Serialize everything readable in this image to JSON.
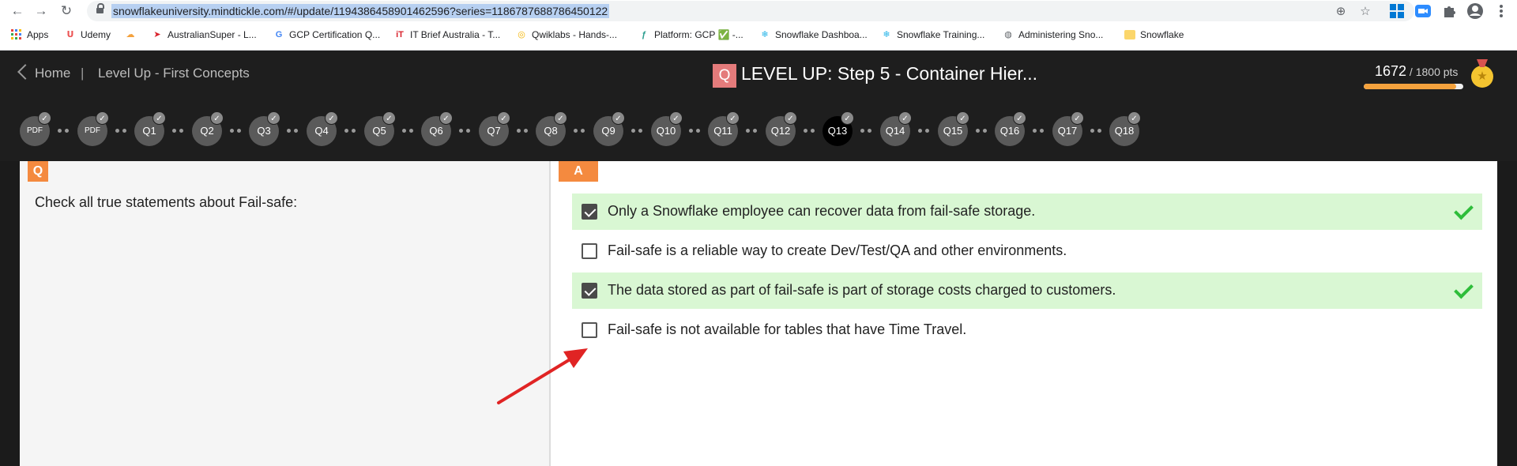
{
  "browser": {
    "url": "snowflakeuniversity.mindtickle.com/#/update/1194386458901462596?series=1186787688786450122",
    "bookmarks": [
      {
        "label": "Apps",
        "icon": "apps-grid-icon"
      },
      {
        "label": "Udemy",
        "icon": "udemy-icon"
      },
      {
        "label": "",
        "icon": "cloud-icon"
      },
      {
        "label": "AustralianSuper - L...",
        "icon": "australiansuper-icon"
      },
      {
        "label": "GCP Certification Q...",
        "icon": "google-icon"
      },
      {
        "label": "IT Brief Australia - T...",
        "icon": "itbrief-icon"
      },
      {
        "label": "Qwiklabs - Hands-...",
        "icon": "qwiklabs-icon"
      },
      {
        "label": "Platform: GCP ✅ -...",
        "icon": "platform-icon"
      },
      {
        "label": "Snowflake Dashboa...",
        "icon": "snowflake-icon"
      },
      {
        "label": "Snowflake Training...",
        "icon": "snowflake-icon"
      },
      {
        "label": "Administering Sno...",
        "icon": "globe-icon"
      },
      {
        "label": "Snowflake",
        "icon": "folder-icon"
      }
    ]
  },
  "header": {
    "home_label": "Home",
    "separator": "|",
    "breadcrumb": "Level Up - First Concepts",
    "title_badge": "Q",
    "title": "LEVEL UP: Step 5 - Container Hier...",
    "points": "1672",
    "points_total": " / 1800 pts",
    "progress": 0.93
  },
  "steps": [
    "PDF",
    "PDF",
    "Q1",
    "Q2",
    "Q3",
    "Q4",
    "Q5",
    "Q6",
    "Q7",
    "Q8",
    "Q9",
    "Q10",
    "Q11",
    "Q12",
    "Q13",
    "Q14",
    "Q15",
    "Q16",
    "Q17",
    "Q18"
  ],
  "active_step": 14,
  "question": {
    "tab": "Q",
    "text": "Check all true statements about Fail-safe:"
  },
  "answers": {
    "tab": "A",
    "options": [
      {
        "text": "Only a Snowflake employee can recover data from fail-safe storage.",
        "checked": true,
        "correct": true
      },
      {
        "text": "Fail-safe is a reliable way to create Dev/Test/QA and other environments.",
        "checked": false,
        "correct": false
      },
      {
        "text": "The data stored as part of fail-safe is part of storage costs charged to customers.",
        "checked": true,
        "correct": true
      },
      {
        "text": "Fail-safe is not available for tables that have Time Travel.",
        "checked": false,
        "correct": false
      }
    ]
  },
  "colors": {
    "accent": "#f48a3f",
    "correct_bg": "#d9f7d3",
    "correct_tick": "#2ebd3a",
    "arrow": "#e02424"
  }
}
